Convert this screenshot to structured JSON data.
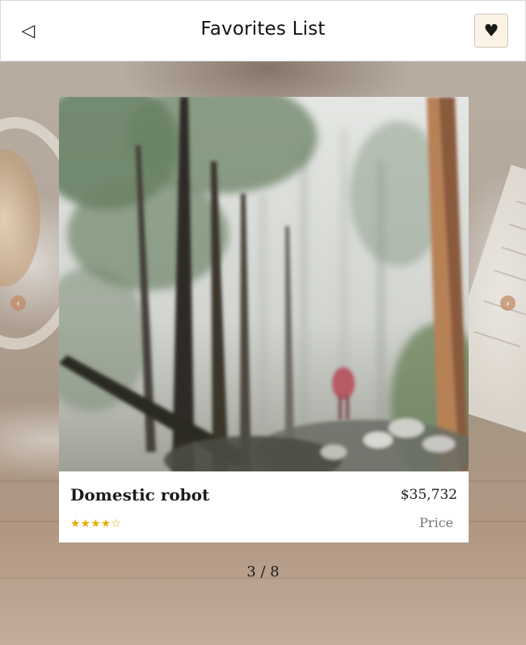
{
  "header": {
    "title": "Favorites List",
    "back_icon": "back-triangle-icon",
    "favorite_icon": "heart-icon",
    "back_glyph": "◁",
    "heart_glyph": "♥"
  },
  "carousel": {
    "prev_glyph": "‹",
    "next_glyph": "›",
    "pager": "3 / 8",
    "current_index": 3,
    "total": 8
  },
  "product": {
    "name": "Domestic robot",
    "price": "$35,732",
    "price_label": "Price",
    "rating_stars": "★★★★☆",
    "rating_value": 4,
    "rating_max": 5,
    "image_subject": "misty forest with tall trees and a figure in red"
  },
  "colors": {
    "accent_button_bg": "#fbf3e6",
    "nav_arrow": "#c08b67",
    "star": "#e6b000"
  }
}
